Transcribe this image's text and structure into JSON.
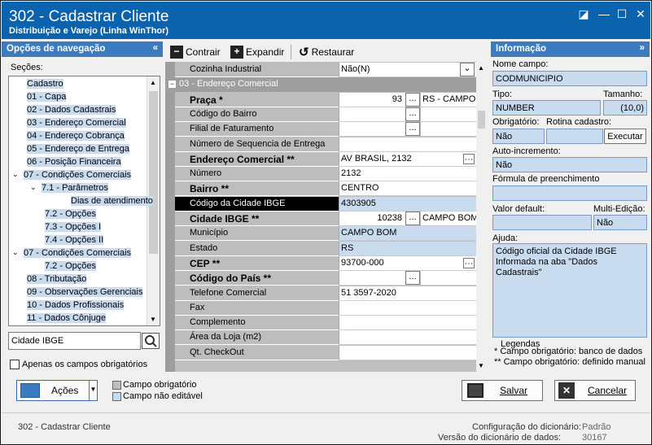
{
  "window": {
    "title": "302 - Cadastrar Cliente",
    "subtitle": "Distribuição e Varejo (Linha WinThor)"
  },
  "nav": {
    "header": "Opções de navegação",
    "sections_label": "Seções:",
    "items": [
      {
        "label": "Cadastro",
        "indent": 1,
        "toggle": ""
      },
      {
        "label": "01 - Capa",
        "indent": 1,
        "toggle": ""
      },
      {
        "label": "02 - Dados Cadastrais",
        "indent": 1,
        "toggle": ""
      },
      {
        "label": "03 - Endereço Comercial",
        "indent": 1,
        "toggle": ""
      },
      {
        "label": "04 - Endereço Cobrança",
        "indent": 1,
        "toggle": ""
      },
      {
        "label": "05 - Endereço de Entrega",
        "indent": 1,
        "toggle": ""
      },
      {
        "label": "06 - Posição Financeira",
        "indent": 1,
        "toggle": ""
      },
      {
        "label": "07 - Condições Comerciais",
        "indent": 1,
        "toggle": "v"
      },
      {
        "label": "7.1 - Parâmetros",
        "indent": 2,
        "toggle": "v"
      },
      {
        "label": "Dias de atendimento",
        "indent": 3,
        "toggle": ""
      },
      {
        "label": "7.2 - Opções",
        "indent": 2,
        "toggle": ""
      },
      {
        "label": "7.3 - Opções I",
        "indent": 2,
        "toggle": ""
      },
      {
        "label": "7.4 - Opções II",
        "indent": 2,
        "toggle": ""
      },
      {
        "label": "07 - Condições Comerciais",
        "indent": 1,
        "toggle": "v"
      },
      {
        "label": "7.2 - Opções",
        "indent": 2,
        "toggle": ""
      },
      {
        "label": "08 - Tributação",
        "indent": 1,
        "toggle": ""
      },
      {
        "label": "09 - Observações Gerenciais",
        "indent": 1,
        "toggle": ""
      },
      {
        "label": "10 - Dados Profissionais",
        "indent": 1,
        "toggle": ""
      },
      {
        "label": "11 - Dados Cônjuge",
        "indent": 1,
        "toggle": ""
      }
    ],
    "search_value": "Cidade IBGE",
    "only_required_label": "Apenas os campos obrigatórios"
  },
  "toolbar": {
    "collapse": "Contrair",
    "expand": "Expandir",
    "restore": "Restaurar"
  },
  "grid": {
    "rows": [
      {
        "label": "Cozinha Industrial",
        "value": "Não(N)",
        "bold": false,
        "kind": "combo"
      },
      {
        "label": "03 - Endereço Comercial",
        "value": "",
        "bold": false,
        "kind": "group"
      },
      {
        "label": "Praça *",
        "value": "93",
        "extra": "RS - CAMPO I",
        "bold": true,
        "kind": "btnnum"
      },
      {
        "label": "Código do Bairro",
        "value": "",
        "bold": false,
        "kind": "btn"
      },
      {
        "label": "Filial de Faturamento",
        "value": "",
        "bold": false,
        "kind": "btn"
      },
      {
        "label": "Número de Sequencia de Entrega",
        "value": "",
        "bold": false,
        "kind": "plain"
      },
      {
        "label": "Endereço Comercial **",
        "value": "AV BRASIL, 2132",
        "bold": true,
        "kind": "dots"
      },
      {
        "label": "Número",
        "value": "2132",
        "bold": false,
        "kind": "plain"
      },
      {
        "label": "Bairro **",
        "value": "CENTRO",
        "bold": true,
        "kind": "plain"
      },
      {
        "label": "Código da Cidade IBGE",
        "value": "4303905",
        "bold": false,
        "kind": "selected"
      },
      {
        "label": "Cidade IBGE **",
        "value": "10238",
        "extra": "CAMPO BOM",
        "bold": true,
        "kind": "btnnum"
      },
      {
        "label": "Município",
        "value": "CAMPO BOM",
        "bold": false,
        "kind": "readonly"
      },
      {
        "label": "Estado",
        "value": "RS",
        "bold": false,
        "kind": "readonly"
      },
      {
        "label": "CEP **",
        "value": "93700-000",
        "bold": true,
        "kind": "dots"
      },
      {
        "label": "Código do País **",
        "value": "",
        "bold": true,
        "kind": "btn"
      },
      {
        "label": "Telefone Comercial",
        "value": "51 3597-2020",
        "bold": false,
        "kind": "plain"
      },
      {
        "label": "Fax",
        "value": "",
        "bold": false,
        "kind": "plain"
      },
      {
        "label": "Complemento",
        "value": "",
        "bold": false,
        "kind": "plain"
      },
      {
        "label": "Área da Loja (m2)",
        "value": "",
        "bold": false,
        "kind": "plain"
      },
      {
        "label": "Qt. CheckOut",
        "value": "",
        "bold": false,
        "kind": "plain"
      }
    ]
  },
  "info": {
    "header": "Informação",
    "field_name_label": "Nome campo:",
    "field_name": "CODMUNICIPIO",
    "type_label": "Tipo:",
    "type": "NUMBER",
    "size_label": "Tamanho:",
    "size": "(10,0)",
    "required_label": "Obrigatório:",
    "required": "Não",
    "routine_label": "Rotina cadastro:",
    "execute": "Executar",
    "autoinc_label": "Auto-incremento:",
    "autoinc": "Não",
    "formula_label": "Fórmula de preenchimento",
    "default_label": "Valor default:",
    "multi_label": "Multi-Edição:",
    "multi": "Não",
    "help_label": "Ajuda:",
    "help_text": "Código oficial da Cidade IBGE Informada na aba \"Dados Cadastrais\"",
    "legend_title": "Legendas",
    "legend1": "* Campo obrigatório: banco de dados",
    "legend2": "** Campo obrigatório: definido manual"
  },
  "bottom": {
    "actions": "Ações",
    "legend_required": "Campo obrigatório",
    "legend_readonly": "Campo não editável",
    "save": "Salvar",
    "cancel": "Cancelar"
  },
  "status": {
    "left": "302 - Cadastrar Cliente",
    "config_label": "Configuração do dicionário:",
    "config_value": "Padrão",
    "version_label": "Versão do dicionário de dados:",
    "version_value": "30167"
  },
  "colors": {
    "title_bar": "#0b62ad",
    "panel_header": "#3b7bbf",
    "selected_row": "#000000",
    "info_field": "#c9dbee"
  }
}
